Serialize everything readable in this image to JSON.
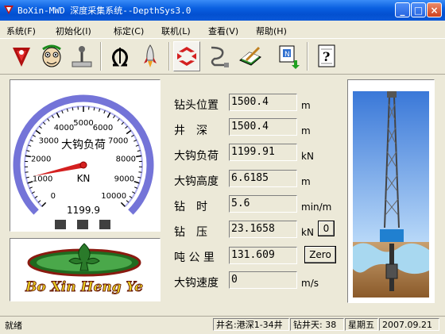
{
  "window": {
    "title": "BoXin-MWD 深度采集系统--DepthSys3.0",
    "minimize": "_",
    "maximize": "□",
    "close": "×"
  },
  "menu": [
    {
      "label": "系统(F)"
    },
    {
      "label": "初始化(I)"
    },
    {
      "label": "标定(C)"
    },
    {
      "label": "联机(L)"
    },
    {
      "label": "查看(V)"
    },
    {
      "label": "帮助(H)"
    }
  ],
  "toolbar": {
    "icons": [
      "boxin-logo-icon",
      "face-icon",
      "joystick-icon",
      "omega-icon",
      "rocket-icon",
      "sync-arrows-icon",
      "cable-plug-icon",
      "writing-book-icon",
      "notepad-download-icon",
      "help-document-icon"
    ],
    "selected": "sync-arrows-icon"
  },
  "gauge": {
    "title": "大钩负荷",
    "unit": "KN",
    "value_text": "1199.9",
    "value": 1199.9,
    "min": 0,
    "max": 10000,
    "tick_labels": [
      "0",
      "1000",
      "2000",
      "3000",
      "4000",
      "5000",
      "6000",
      "7000",
      "8000",
      "9000",
      "10000"
    ],
    "indicator_count": 3,
    "colors": {
      "needle": "#d42020",
      "arc": "#8f8fe8",
      "indicator": "#404040"
    }
  },
  "logo": {
    "text": "Bo Xin Heng Ye",
    "colors": {
      "text": "#e8d020",
      "emblem": "#2a7a2a",
      "outline": "#8a1a10"
    }
  },
  "readings": [
    {
      "label": "钻头位置",
      "value": "1500.4",
      "unit": "m"
    },
    {
      "label": "井　深",
      "value": "1500.4",
      "unit": "m"
    },
    {
      "label": "大钩负荷",
      "value": "1199.91",
      "unit": "kN"
    },
    {
      "label": "大钩高度",
      "value": "6.6185",
      "unit": "m"
    },
    {
      "label": "钻　时",
      "value": "5.6",
      "unit": "min/m"
    },
    {
      "label": "钻　压",
      "value": "23.1658",
      "unit": "kN"
    },
    {
      "label": "吨 公 里",
      "value": "131.609",
      "unit": ""
    },
    {
      "label": "大钩速度",
      "value": "0",
      "unit": "m/s"
    }
  ],
  "buttons": {
    "wob_zero": "0",
    "tonkm_zero": "Zero"
  },
  "status": {
    "ready": "就绪",
    "well_name": "井名:港深1-34井",
    "drill_days": "钻井天: 38",
    "weekday": "星期五",
    "date": "2007.09.21"
  }
}
